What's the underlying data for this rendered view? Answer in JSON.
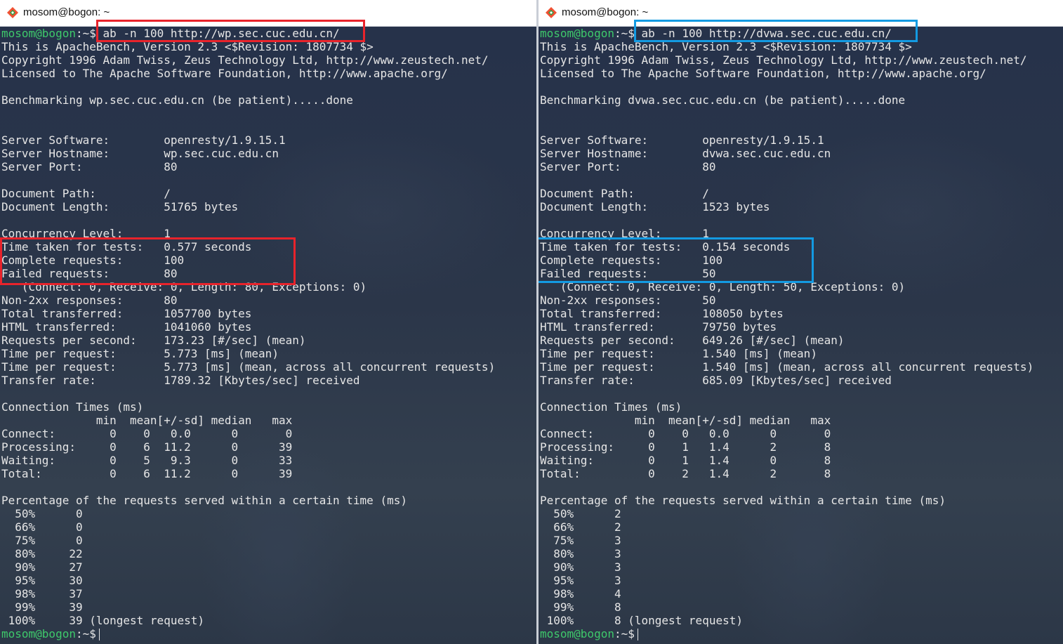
{
  "left": {
    "title": "mosom@bogon: ~",
    "prompt_user": "mosom@bogon",
    "prompt_suffix": ":~$",
    "command": "ab -n 100 http://wp.sec.cuc.edu.cn/",
    "output": [
      "This is ApacheBench, Version 2.3 <$Revision: 1807734 $>",
      "Copyright 1996 Adam Twiss, Zeus Technology Ltd, http://www.zeustech.net/",
      "Licensed to The Apache Software Foundation, http://www.apache.org/",
      "",
      "Benchmarking wp.sec.cuc.edu.cn (be patient).....done",
      "",
      "",
      "Server Software:        openresty/1.9.15.1",
      "Server Hostname:        wp.sec.cuc.edu.cn",
      "Server Port:            80",
      "",
      "Document Path:          /",
      "Document Length:        51765 bytes",
      "",
      "Concurrency Level:      1",
      "Time taken for tests:   0.577 seconds",
      "Complete requests:      100",
      "Failed requests:        80",
      "   (Connect: 0, Receive: 0, Length: 80, Exceptions: 0)",
      "Non-2xx responses:      80",
      "Total transferred:      1057700 bytes",
      "HTML transferred:       1041060 bytes",
      "Requests per second:    173.23 [#/sec] (mean)",
      "Time per request:       5.773 [ms] (mean)",
      "Time per request:       5.773 [ms] (mean, across all concurrent requests)",
      "Transfer rate:          1789.32 [Kbytes/sec] received",
      "",
      "Connection Times (ms)",
      "              min  mean[+/-sd] median   max",
      "Connect:        0    0   0.0      0       0",
      "Processing:     0    6  11.2      0      39",
      "Waiting:        0    5   9.3      0      33",
      "Total:          0    6  11.2      0      39",
      "",
      "Percentage of the requests served within a certain time (ms)",
      "  50%      0",
      "  66%      0",
      "  75%      0",
      "  80%     22",
      "  90%     27",
      "  95%     30",
      "  98%     37",
      "  99%     39",
      " 100%     39 (longest request)"
    ]
  },
  "right": {
    "title": "mosom@bogon: ~",
    "prompt_user": "mosom@bogon",
    "prompt_suffix": ":~$",
    "command": "ab -n 100 http://dvwa.sec.cuc.edu.cn/",
    "output": [
      "This is ApacheBench, Version 2.3 <$Revision: 1807734 $>",
      "Copyright 1996 Adam Twiss, Zeus Technology Ltd, http://www.zeustech.net/",
      "Licensed to The Apache Software Foundation, http://www.apache.org/",
      "",
      "Benchmarking dvwa.sec.cuc.edu.cn (be patient).....done",
      "",
      "",
      "Server Software:        openresty/1.9.15.1",
      "Server Hostname:        dvwa.sec.cuc.edu.cn",
      "Server Port:            80",
      "",
      "Document Path:          /",
      "Document Length:        1523 bytes",
      "",
      "Concurrency Level:      1",
      "Time taken for tests:   0.154 seconds",
      "Complete requests:      100",
      "Failed requests:        50",
      "   (Connect: 0, Receive: 0, Length: 50, Exceptions: 0)",
      "Non-2xx responses:      50",
      "Total transferred:      108050 bytes",
      "HTML transferred:       79750 bytes",
      "Requests per second:    649.26 [#/sec] (mean)",
      "Time per request:       1.540 [ms] (mean)",
      "Time per request:       1.540 [ms] (mean, across all concurrent requests)",
      "Transfer rate:          685.09 [Kbytes/sec] received",
      "",
      "Connection Times (ms)",
      "              min  mean[+/-sd] median   max",
      "Connect:        0    0   0.0      0       0",
      "Processing:     0    1   1.4      2       8",
      "Waiting:        0    1   1.4      0       8",
      "Total:          0    2   1.4      2       8",
      "",
      "Percentage of the requests served within a certain time (ms)",
      "  50%      2",
      "  66%      2",
      "  75%      3",
      "  80%      3",
      "  90%      3",
      "  95%      3",
      "  98%      4",
      "  99%      8",
      " 100%      8 (longest request)"
    ]
  },
  "colors": {
    "prompt": "#3ec96b",
    "highlight_left": "#e8232b",
    "highlight_right": "#139ae2",
    "terminal_bg": "#2a3648",
    "text": "#e6e6e6"
  },
  "icons": {
    "title_icon": "git-bash-diamond-icon"
  }
}
